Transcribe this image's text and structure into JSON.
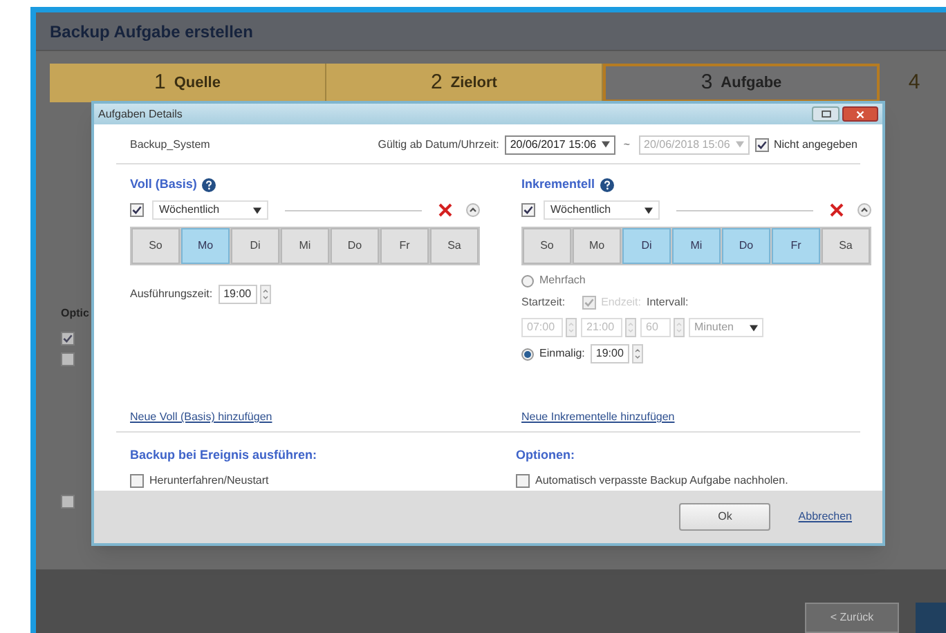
{
  "window": {
    "title": "Backup Aufgabe erstellen"
  },
  "steps": [
    {
      "number": "1",
      "label": "Quelle",
      "selected": false
    },
    {
      "number": "2",
      "label": "Zielort",
      "selected": false
    },
    {
      "number": "3",
      "label": "Aufgabe",
      "selected": true
    },
    {
      "number": "4",
      "selected": false
    }
  ],
  "background": {
    "section_label": "Optic",
    "checkboxes": [
      {
        "checked": true
      },
      {
        "checked": false
      },
      {
        "checked": false
      }
    ]
  },
  "dialog": {
    "title": "Aufgaben Details",
    "task_name": "Backup_System",
    "valid_from_label": "Gültig ab Datum/Uhrzeit:",
    "valid_from": "20/06/2017 15:06",
    "separator": "~",
    "valid_to": "20/06/2018 15:06",
    "unspecified": {
      "label": "Nicht angegeben",
      "checked": true
    },
    "schedules": [
      {
        "kind": "full",
        "title": "Voll (Basis)",
        "enabled": true,
        "frequency": "Wöchentlich",
        "days": [
          {
            "label": "So",
            "selected": false
          },
          {
            "label": "Mo",
            "selected": true
          },
          {
            "label": "Di",
            "selected": false
          },
          {
            "label": "Mi",
            "selected": false
          },
          {
            "label": "Do",
            "selected": false
          },
          {
            "label": "Fr",
            "selected": false
          },
          {
            "label": "Sa",
            "selected": false
          }
        ],
        "time_label": "Ausführungszeit:",
        "time": "19:00",
        "add_link": "Neue Voll (Basis) hinzufügen"
      },
      {
        "kind": "incremental",
        "title": "Inkrementell",
        "enabled": true,
        "frequency": "Wöchentlich",
        "days": [
          {
            "label": "So",
            "selected": false
          },
          {
            "label": "Mo",
            "selected": false
          },
          {
            "label": "Di",
            "selected": true
          },
          {
            "label": "Mi",
            "selected": true
          },
          {
            "label": "Do",
            "selected": true
          },
          {
            "label": "Fr",
            "selected": true
          },
          {
            "label": "Sa",
            "selected": false
          }
        ],
        "multiple": {
          "label": "Mehrfach",
          "selected": false,
          "start_label": "Startzeit:",
          "end_label": "Endzeit:",
          "end_checked": true,
          "interval_label": "Intervall:",
          "start": "07:00",
          "end": "21:00",
          "interval": "60",
          "unit": "Minuten"
        },
        "once": {
          "label": "Einmalig:",
          "selected": true,
          "time": "19:00"
        },
        "add_link": "Neue Inkrementelle hinzufügen"
      }
    ],
    "event": {
      "title": "Backup bei Ereignis ausführen:",
      "options": [
        {
          "label": "Herunterfahren/Neustart",
          "checked": false
        }
      ]
    },
    "options": {
      "title": "Optionen:",
      "options": [
        {
          "label": "Automatisch verpasste Backup Aufgabe nachholen.",
          "checked": false
        }
      ]
    },
    "buttons": {
      "ok": "Ok",
      "cancel": "Abbrechen"
    }
  },
  "footer": {
    "back": "< Zurück"
  }
}
